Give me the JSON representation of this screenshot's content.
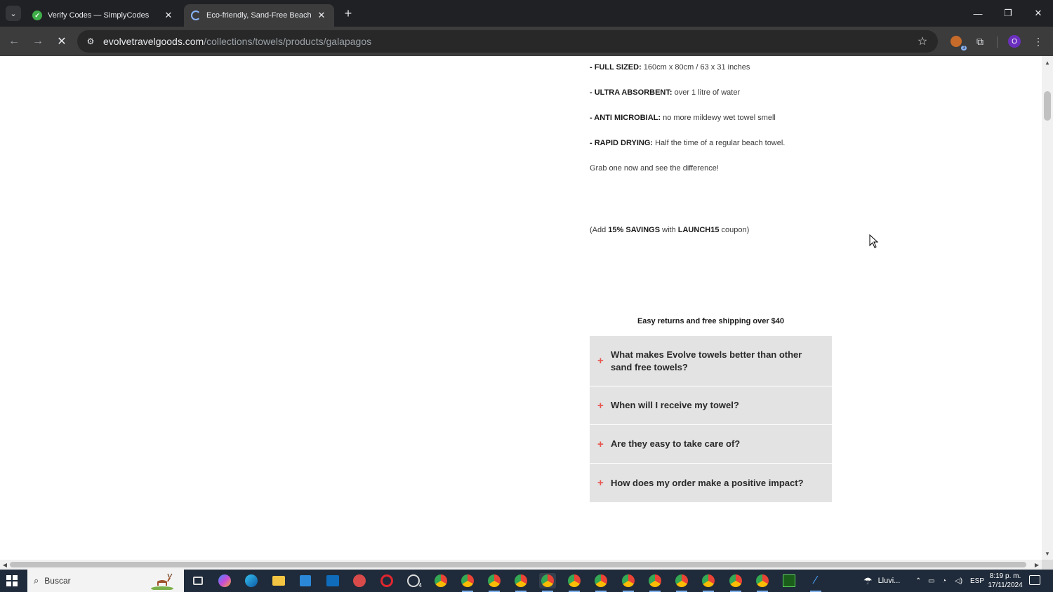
{
  "browser": {
    "tabs": [
      {
        "title": "Verify Codes — SimplyCodes",
        "favicon": "simplycodes-icon",
        "active": false
      },
      {
        "title": "Eco-friendly, Sand-Free Beach and Tr",
        "favicon": "loading-spinner-icon",
        "active": true
      }
    ],
    "url_host": "evolvetravelgoods.com",
    "url_path": "/collections/towels/products/galapagos",
    "profile_initial": "O",
    "extension_badge": "3"
  },
  "page": {
    "features": [
      {
        "label": "- FULL SIZED:",
        "text": " 160cm x 80cm / 63 x 31 inches"
      },
      {
        "label": "- ULTRA ABSORBENT:",
        "text": " over 1 litre of water"
      },
      {
        "label": "- ANTI MICROBIAL:",
        "text": " no more mildewy wet towel smell"
      },
      {
        "label": "- RAPID DRYING:",
        "text": " Half the time of a regular beach towel."
      }
    ],
    "cta": "Grab one now and see the difference!",
    "coupon": {
      "prefix": "(Add ",
      "savings": "15% SAVINGS",
      "middle": " with ",
      "code": "LAUNCH15",
      "suffix": " coupon)"
    },
    "shipping_note": "Easy returns and free shipping over $40",
    "faq": [
      {
        "question": "What makes Evolve towels better than other sand free towels?"
      },
      {
        "question": "When will I receive my towel?"
      },
      {
        "question": "Are they easy to take care of?"
      },
      {
        "question": "How does my order make a positive impact?"
      }
    ],
    "faq_accent_color": "#e8554e"
  },
  "taskbar": {
    "search_placeholder": "Buscar",
    "weather": "Lluvi...",
    "language": "ESP",
    "time": "8:19 p. m.",
    "date": "17/11/2024",
    "whatsapp_badge": "4"
  }
}
